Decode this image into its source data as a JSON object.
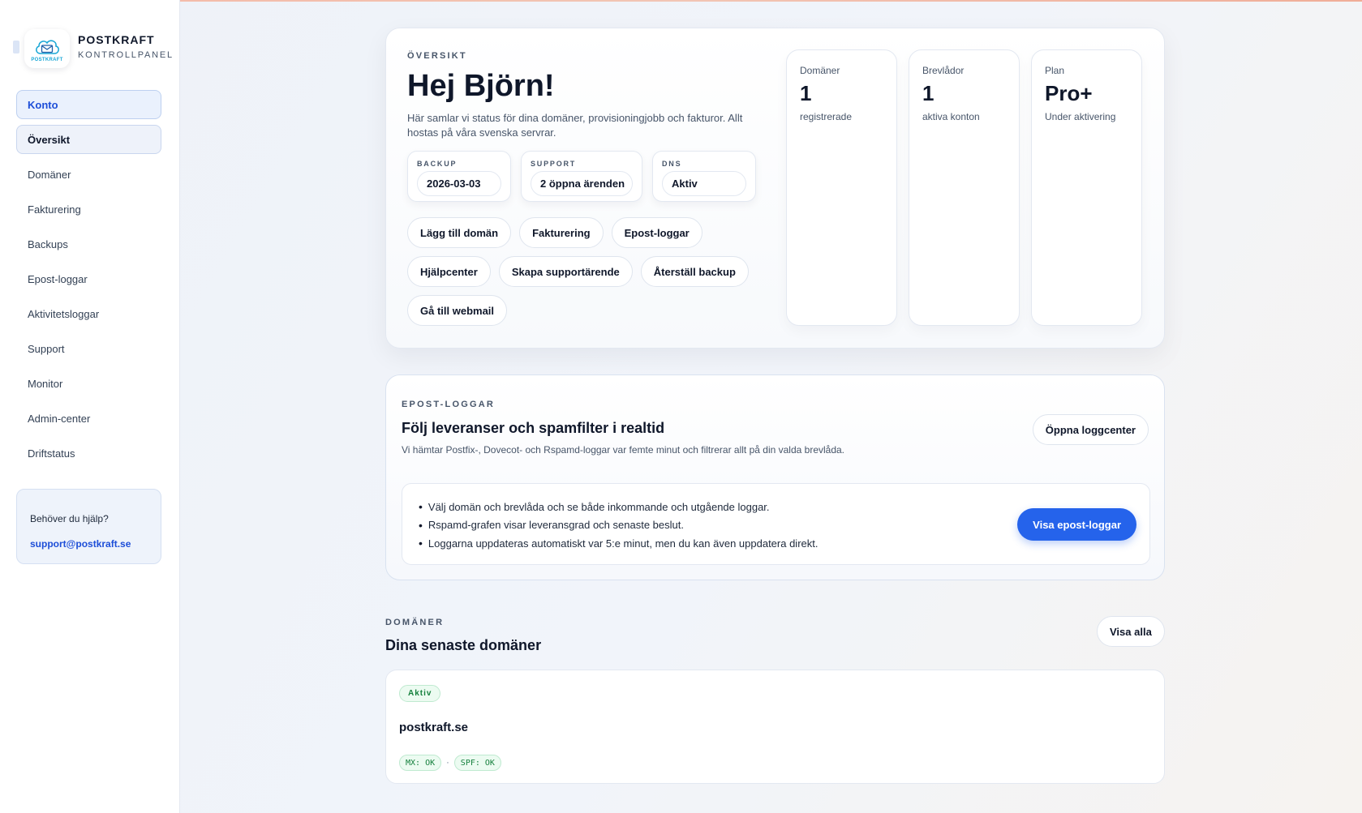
{
  "brand": {
    "logo_text": "POSTKRAFT",
    "name": "POSTKRAFT",
    "subtitle": "KONTROLLPANEL"
  },
  "sidebar": {
    "items": [
      {
        "label": "Konto"
      },
      {
        "label": "Översikt"
      },
      {
        "label": "Domäner"
      },
      {
        "label": "Fakturering"
      },
      {
        "label": "Backups"
      },
      {
        "label": "Epost-loggar"
      },
      {
        "label": "Aktivitetsloggar"
      },
      {
        "label": "Support"
      },
      {
        "label": "Monitor"
      },
      {
        "label": "Admin-center"
      },
      {
        "label": "Driftstatus"
      }
    ],
    "help": {
      "question": "Behöver du hjälp?",
      "email": "support@postkraft.se"
    }
  },
  "overview": {
    "eyebrow": "ÖVERSIKT",
    "greeting": "Hej Björn!",
    "description": "Här samlar vi status för dina domäner, provisioningjobb och fakturor. Allt hostas på våra svenska servrar.",
    "mini": [
      {
        "label": "BACKUP",
        "value": "2026-03-03"
      },
      {
        "label": "SUPPORT",
        "value": "2 öppna ärenden"
      },
      {
        "label": "DNS",
        "value": "Aktiv"
      }
    ],
    "actions": [
      "Lägg till domän",
      "Fakturering",
      "Epost-loggar",
      "Hjälpcenter",
      "Skapa supportärende",
      "Återställ backup",
      "Gå till webmail"
    ],
    "stats": [
      {
        "label": "Domäner",
        "value": "1",
        "sub": "registrerade"
      },
      {
        "label": "Brevlådor",
        "value": "1",
        "sub": "aktiva konton"
      },
      {
        "label": "Plan",
        "value": "Pro+",
        "sub": "Under aktivering"
      }
    ]
  },
  "logs": {
    "eyebrow": "EPOST-LOGGAR",
    "title": "Följ leveranser och spamfilter i realtid",
    "description": "Vi hämtar Postfix-, Dovecot- och Rspamd-loggar var femte minut och filtrerar allt på din valda brevlåda.",
    "open_label": "Öppna loggcenter",
    "bullets": [
      "Välj domän och brevlåda och se både inkommande och utgående loggar.",
      "Rspamd-grafen visar leveransgrad och senaste beslut.",
      "Loggarna uppdateras automatiskt var 5:e minut, men du kan även uppdatera direkt."
    ],
    "view_label": "Visa epost-loggar"
  },
  "domains": {
    "eyebrow": "DOMÄNER",
    "title": "Dina senaste domäner",
    "view_all": "Visa alla",
    "items": [
      {
        "status": "Aktiv",
        "name": "postkraft.se",
        "mx": "MX: OK",
        "separator": "·",
        "spf": "SPF: OK"
      }
    ]
  },
  "colors": {
    "accent": "#2563eb",
    "success": "#15803d",
    "success_bg": "#ecfbf1"
  }
}
